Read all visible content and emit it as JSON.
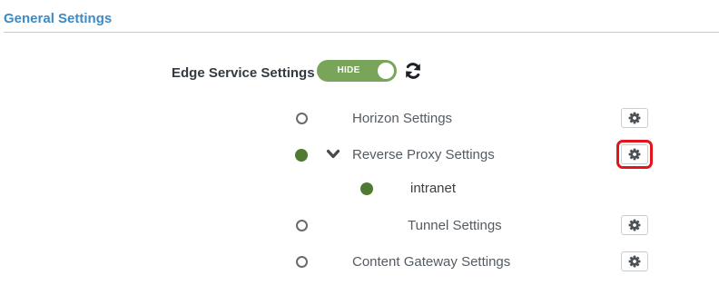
{
  "section": {
    "title": "General Settings"
  },
  "edge_service": {
    "label": "Edge Service Settings",
    "toggle_label": "HIDE",
    "toggle_state": "on",
    "refresh_icon": "refresh-icon"
  },
  "items": [
    {
      "label": "Horizon Settings",
      "radio": "empty",
      "icon": "gear-icon"
    },
    {
      "label": "Reverse Proxy Settings",
      "radio": "filled",
      "expand_icon": "chevron-down-icon",
      "icon": "gear-icon",
      "highlighted": true
    },
    {
      "label": "intranet",
      "radio": "filled"
    },
    {
      "label": "Tunnel Settings",
      "radio": "empty",
      "icon": "gear-icon"
    },
    {
      "label": "Content Gateway Settings",
      "radio": "empty",
      "icon": "gear-icon"
    }
  ],
  "colors": {
    "title": "#3d8ac4",
    "toggle_on": "#78a55a",
    "radio_filled": "#4e7a31",
    "highlight": "#e3141b"
  }
}
